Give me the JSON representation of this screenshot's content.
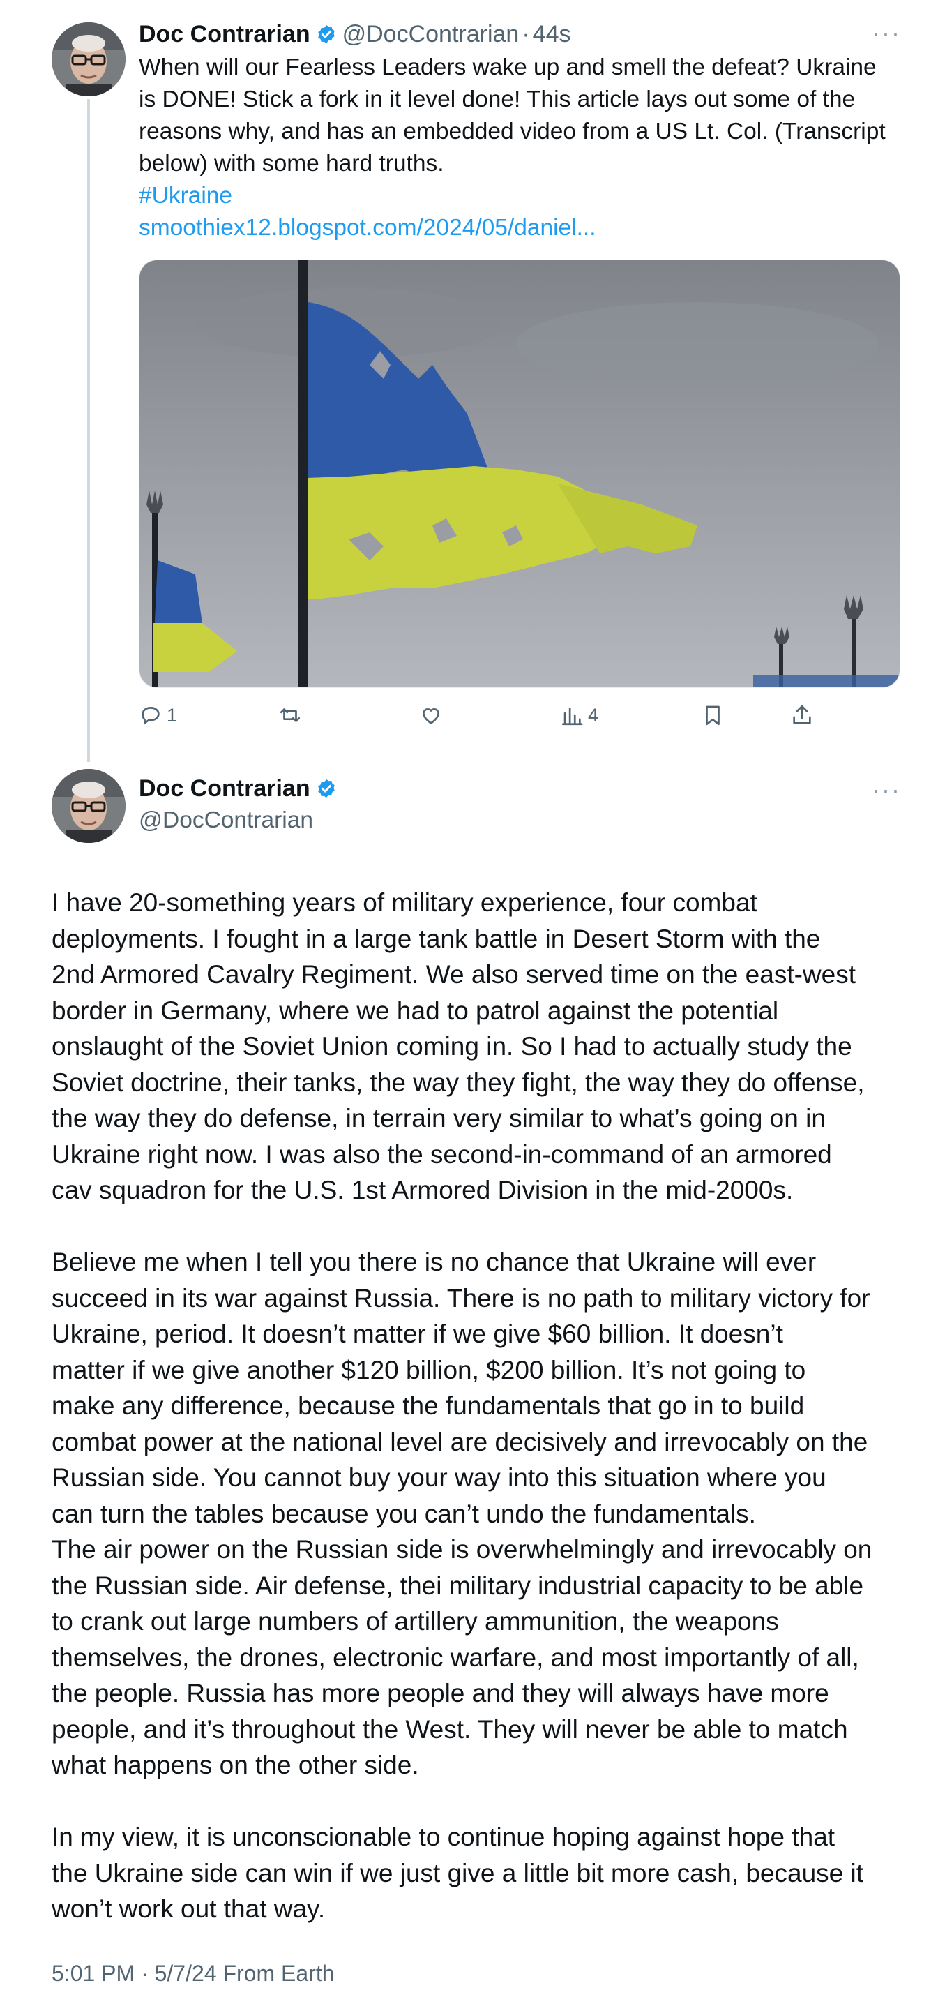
{
  "tweet1": {
    "display_name": "Doc Contrarian",
    "handle": "@DocContrarian",
    "separator": "·",
    "time_ago": "44s",
    "more_label": "···",
    "text_lines": [
      "When will our Fearless Leaders wake up and smell the defeat? Ukraine",
      "is DONE! Stick a fork in it level done! This article lays out some of the",
      "reasons why, and has an embedded video from a US Lt. Col. (Transcript",
      "below) with some hard truths."
    ],
    "hashtag": "#Ukraine",
    "link": "smoothiex12.blogspot.com/2024/05/daniel...",
    "actions": {
      "reply_count": "1",
      "retweet_count": "",
      "like_count": "",
      "views_count": "4"
    }
  },
  "tweet2": {
    "display_name": "Doc Contrarian",
    "handle": "@DocContrarian",
    "more_label": "···",
    "paragraphs": [
      [
        "I have 20-something years of military experience, four combat",
        "deployments. I fought in a large tank battle in Desert Storm with the",
        "2nd Armored Cavalry Regiment. We also served time on the east-west",
        "border in Germany, where we had to patrol against the potential",
        "onslaught of the Soviet Union coming in. So I had to actually study the",
        "Soviet doctrine, their tanks, the way they fight, the way they do offense,",
        "the way they do defense, in terrain very similar to what’s going on in",
        "Ukraine right now. I was also the second-in-command of an armored",
        "cav squadron for the U.S. 1st Armored Division in the mid-2000s."
      ],
      [
        "Believe me when I tell you there is no chance that Ukraine will ever",
        "succeed in its war against Russia. There is no path to military victory for",
        "Ukraine, period. It doesn’t matter if we give $60 billion. It doesn’t",
        "matter if we give another $120 billion, $200 billion. It’s not going to",
        "make any difference, because the fundamentals that go in to build",
        "combat power at the national level are decisively and irrevocably on the",
        "Russian side. You cannot buy your way into this situation where you",
        "can turn the tables because you can’t undo the fundamentals.",
        "The air power on the Russian side is overwhelmingly and irrevocably on",
        "the Russian side. Air defense, thei military industrial capacity to be able",
        "to crank out large numbers of artillery ammunition, the weapons",
        "themselves, the drones, electronic warfare, and most importantly of all,",
        "the people. Russia has more people and they will always have more",
        "people, and it’s throughout the West. They will never be able to match",
        "what happens on the other side."
      ],
      [
        "In my view, it is unconscionable to continue hoping against hope that",
        "the Ukraine side can win if we just give a little bit more cash, because it",
        "won’t work out that way."
      ]
    ],
    "meta": "5:01 PM · 5/7/24 From Earth"
  },
  "colors": {
    "link": "#1d9bf0",
    "verified": "#1d9bf0",
    "secondary_text": "#536471",
    "thread_line": "#cfd9de"
  }
}
